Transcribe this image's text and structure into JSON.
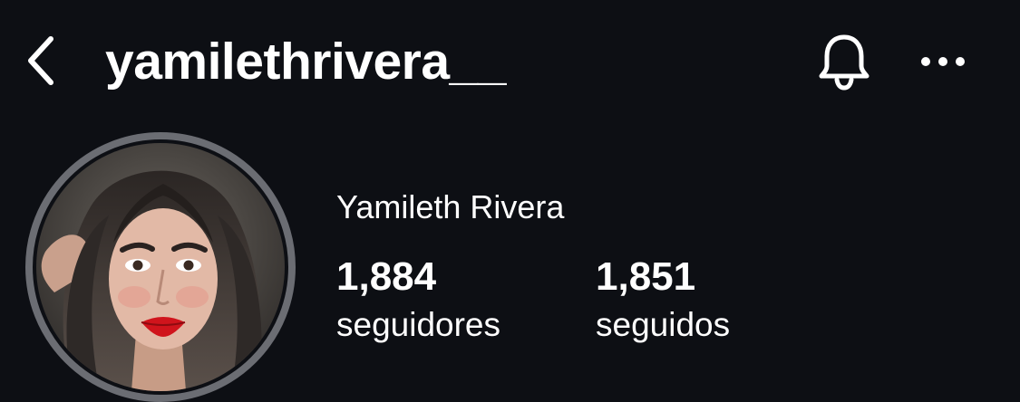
{
  "header": {
    "username": "yamilethrivera__",
    "back_icon": "chevron-left-icon",
    "notification_icon": "bell-icon",
    "more_icon": "more-horizontal-icon"
  },
  "profile": {
    "full_name": "Yamileth Rivera",
    "avatar_icon": "profile-photo",
    "stats": {
      "followers": {
        "count": "1,884",
        "label": "seguidores"
      },
      "following": {
        "count": "1,851",
        "label": "seguidos"
      }
    }
  },
  "colors": {
    "background": "#0d0f14",
    "text": "#ffffff",
    "avatar_ring": "#6b6d73"
  }
}
